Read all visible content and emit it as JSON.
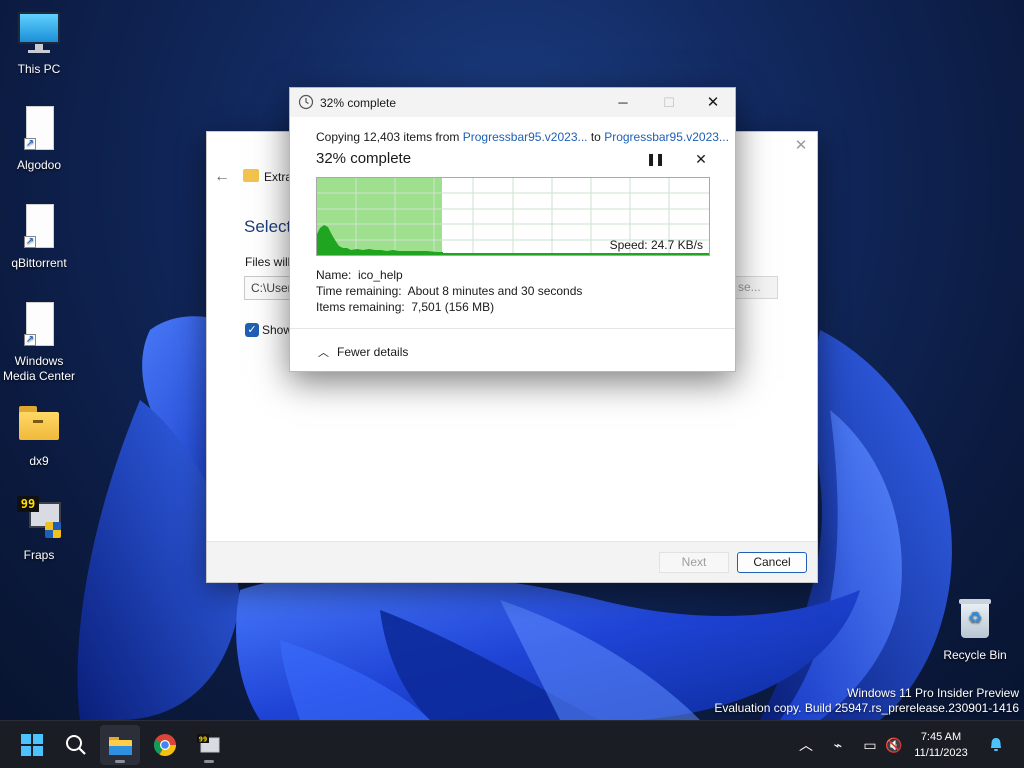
{
  "desktop": {
    "icons": [
      {
        "label": "This PC",
        "icon": "monitor-icon"
      },
      {
        "label": "Algodoo",
        "icon": "shortcut-file-icon"
      },
      {
        "label": "qBittorrent",
        "icon": "shortcut-file-icon"
      },
      {
        "label": "Windows Media Center",
        "icon": "shortcut-file-icon"
      },
      {
        "label": "dx9",
        "icon": "folder-icon"
      },
      {
        "label": "Fraps",
        "icon": "fraps-icon"
      },
      {
        "label": "Recycle Bin",
        "icon": "recycle-bin-icon"
      }
    ],
    "watermark": {
      "line1": "Windows 11 Pro Insider Preview",
      "line2": "Evaluation copy. Build 25947.rs_prerelease.230901-1416"
    }
  },
  "installer": {
    "breadcrumb": "Extra",
    "heading": "Select",
    "files_label": "Files will",
    "path_value": "C:\\User",
    "browse_label": "se...",
    "checkbox_label": "Show",
    "checkbox_checked": true,
    "next_label": "Next",
    "cancel_label": "Cancel"
  },
  "copy_dialog": {
    "title": "32% complete",
    "copy_prefix": "Copying 12,403 items from ",
    "source": "Progressbar95.v2023...",
    "to_word": " to ",
    "destination": "Progressbar95.v2023...",
    "status": "32% complete",
    "progress_percent": 32,
    "speed": "Speed: 24.7 KB/s",
    "name_label": "Name:",
    "name_value": "ico_help",
    "time_label": "Time remaining:",
    "time_value": "About 8 minutes and 30 seconds",
    "items_label": "Items remaining:",
    "items_value": "7,501 (156 MB)",
    "fewer_details": "Fewer details",
    "colors": {
      "progress_fill": "#9fe08f",
      "graph_line": "#1fa51f",
      "link": "#1f5fb5"
    }
  },
  "taskbar": {
    "apps": [
      "start-icon",
      "search-icon",
      "file-explorer-icon",
      "chrome-icon",
      "fraps-icon"
    ],
    "time": "7:45 AM",
    "date": "11/11/2023"
  }
}
